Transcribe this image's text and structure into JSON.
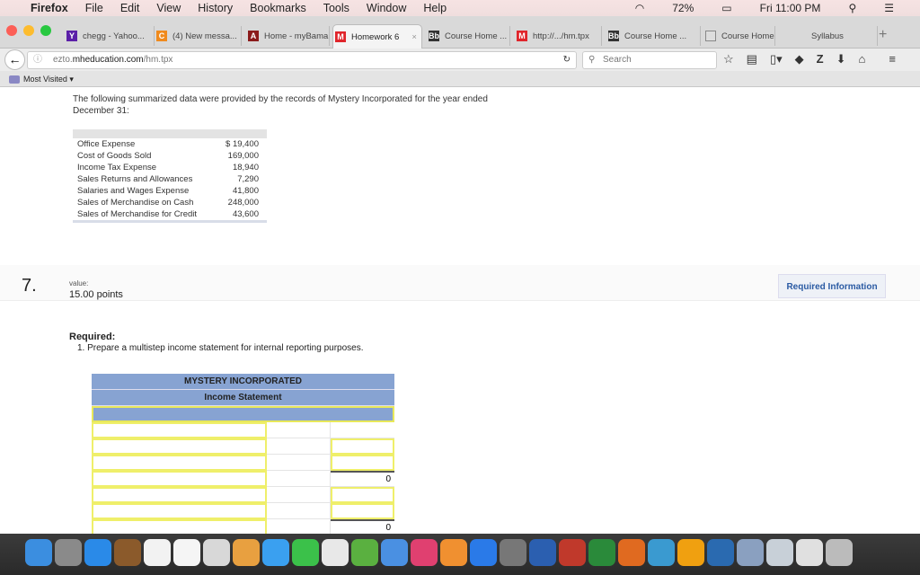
{
  "menubar": {
    "app": "Firefox",
    "items": [
      "File",
      "Edit",
      "View",
      "History",
      "Bookmarks",
      "Tools",
      "Window",
      "Help"
    ],
    "battery": "72%",
    "clock": "Fri 11:00 PM"
  },
  "tabs": [
    {
      "label": "chegg - Yahoo...",
      "fav": "Y",
      "color": "#5b1fa8"
    },
    {
      "label": "(4) New messa...",
      "fav": "C",
      "color": "#f08a1d"
    },
    {
      "label": "Home - myBama",
      "fav": "A",
      "color": "#8b1a1a"
    },
    {
      "label": "Homework 6",
      "fav": "M",
      "color": "#e0252b",
      "active": true
    },
    {
      "label": "Course Home ...",
      "fav": "Bb",
      "color": "#333"
    },
    {
      "label": "http://.../hm.tpx",
      "fav": "M",
      "color": "#e0252b"
    },
    {
      "label": "Course Home ...",
      "fav": "Bb",
      "color": "#333"
    },
    {
      "label": "Course Home",
      "fav": "",
      "color": "#888"
    },
    {
      "label": "Syllabus",
      "fav": "",
      "color": ""
    }
  ],
  "navbar": {
    "url_prefix": "ezto.",
    "url_domain": "mheducation.com",
    "url_path": "/hm.tpx",
    "search_placeholder": "Search"
  },
  "bookmarks": {
    "most_visited": "Most Visited ▾"
  },
  "intro": "The following summarized data were provided by the records of Mystery Incorporated for the year ended December 31:",
  "data_rows": [
    {
      "label": "Office Expense",
      "value": "$ 19,400"
    },
    {
      "label": "Cost of Goods Sold",
      "value": "169,000"
    },
    {
      "label": "Income Tax Expense",
      "value": "18,940"
    },
    {
      "label": "Sales Returns and Allowances",
      "value": "7,290"
    },
    {
      "label": "Salaries and Wages Expense",
      "value": "41,800"
    },
    {
      "label": "Sales of Merchandise on Cash",
      "value": "248,000"
    },
    {
      "label": "Sales of Merchandise for Credit",
      "value": "43,600"
    }
  ],
  "question": {
    "number": "7.",
    "value_label": "value:",
    "points": "15.00 points",
    "required_info": "Required Information",
    "required": "Required:",
    "step": "1.  Prepare a multistep income statement for internal reporting purposes."
  },
  "statement": {
    "company": "MYSTERY INCORPORATED",
    "title": "Income Statement",
    "total1": "0",
    "total2": "0"
  }
}
